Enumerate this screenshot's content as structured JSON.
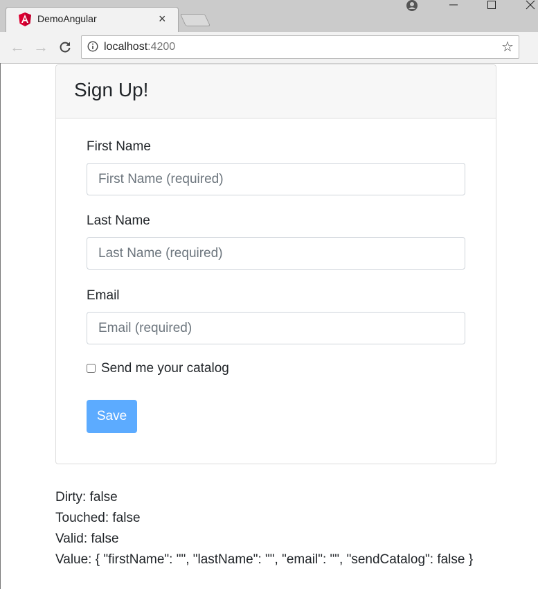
{
  "browser": {
    "tab_title": "DemoAngular",
    "tab_close": "×",
    "url_host": "localhost",
    "url_port": ":4200",
    "icons": {
      "favicon": "angular-icon",
      "back": "back-arrow-icon",
      "forward": "forward-arrow-icon",
      "reload": "reload-icon",
      "info": "info-icon",
      "bookmark": "star-icon",
      "menu": "menu-dots-icon",
      "profile": "profile-icon",
      "minimize": "minimize-icon",
      "maximize": "maximize-icon",
      "close": "close-icon"
    }
  },
  "form": {
    "title": "Sign Up!",
    "first_name": {
      "label": "First Name",
      "value": "",
      "placeholder": "First Name (required)"
    },
    "last_name": {
      "label": "Last Name",
      "value": "",
      "placeholder": "Last Name (required)"
    },
    "email": {
      "label": "Email",
      "value": "",
      "placeholder": "Email (required)"
    },
    "catalog": {
      "label": "Send me your catalog",
      "checked": false
    },
    "save_label": "Save"
  },
  "status": {
    "dirty": "Dirty: false",
    "touched": "Touched: false",
    "valid": "Valid: false",
    "value": "Value: { \"firstName\": \"\", \"lastName\": \"\", \"email\": \"\", \"sendCatalog\": false }"
  },
  "colors": {
    "save_button": "#5cabff",
    "card_header": "#f7f7f7",
    "angular_red": "#dd0031"
  }
}
